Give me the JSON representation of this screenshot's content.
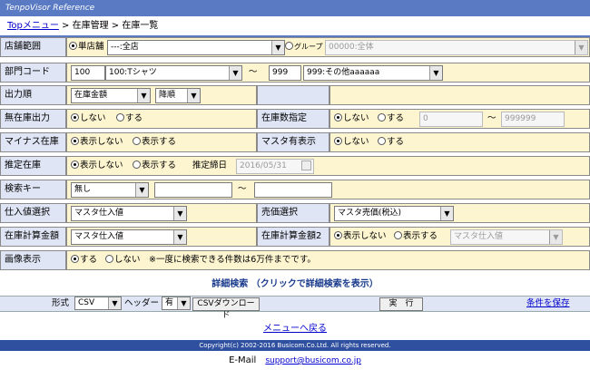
{
  "app": {
    "title": "TenpoVisor Reference"
  },
  "breadcrumb": {
    "top": "Topメニュー",
    "sep1": " > ",
    "level1": "在庫管理",
    "sep2": " > ",
    "level2": "在庫一覧"
  },
  "form": {
    "store_range": {
      "label": "店舗範囲",
      "single_label": "単店舗",
      "store_value": "---:全店",
      "group_label": "グループ",
      "group_value": "00000:全体"
    },
    "dept_code": {
      "label": "部門コード",
      "from_code": "100",
      "from_name": "100:Tシャツ",
      "tilde": "～",
      "to_code": "999",
      "to_name": "999:その他aaaaaa"
    },
    "output_order": {
      "label": "出力順",
      "sort_field": "在庫金額",
      "sort_dir": "降順"
    },
    "no_stock_output": {
      "label": "無在庫出力",
      "opt_no": "しない",
      "opt_yes": "する"
    },
    "stock_qty": {
      "label": "在庫数指定",
      "opt_no": "しない",
      "opt_yes": "する",
      "from": "0",
      "tilde": "～",
      "to": "999999"
    },
    "minus_stock": {
      "label": "マイナス在庫",
      "opt_hide": "表示しない",
      "opt_show": "表示する"
    },
    "master_exist": {
      "label": "マスタ有表示",
      "opt_no": "しない",
      "opt_yes": "する"
    },
    "estimated_stock": {
      "label": "推定在庫",
      "opt_hide": "表示しない",
      "opt_show": "表示する",
      "date_label": "推定締日",
      "date_value": "2016/05/31"
    },
    "search_key": {
      "label": "検索キー",
      "key_value": "無し",
      "tilde": "～"
    },
    "purchase_price": {
      "label": "仕入値選択",
      "value": "マスタ仕入値"
    },
    "sale_price": {
      "label": "売価選択",
      "value": "マスタ売価(税込)"
    },
    "stock_amount": {
      "label": "在庫計算金額",
      "value": "マスタ仕入値"
    },
    "stock_amount2": {
      "label": "在庫計算金額2",
      "opt_hide": "表示しない",
      "opt_show": "表示する",
      "value": "マスタ仕入値"
    },
    "image_display": {
      "label": "画像表示",
      "opt_yes": "する",
      "opt_no": "しない",
      "note": "※一度に検索できる件数は6万件までです。"
    }
  },
  "detail_search": {
    "label": "詳細検索 （クリックで詳細検索を表示）"
  },
  "exec": {
    "format_label": "形式",
    "format_value": "CSV",
    "header_label": "ヘッダー",
    "header_value": "有",
    "csv_download": "CSVダウンロード",
    "execute": "実　行",
    "save_condition": "条件を保存"
  },
  "menu_back": "メニューへ戻る",
  "footer": {
    "copyright": "Copyright(c) 2002-2016 Busicom.Co.Ltd. All rights reserved.",
    "email_label": "E-Mail",
    "email_value": "support@busicom.co.jp"
  },
  "colors": {
    "header_blue": "#5a7bc4",
    "label_bg": "#dfe5f5",
    "value_bg": "#fdf5d0",
    "footer_blue": "#2f4f9f"
  }
}
